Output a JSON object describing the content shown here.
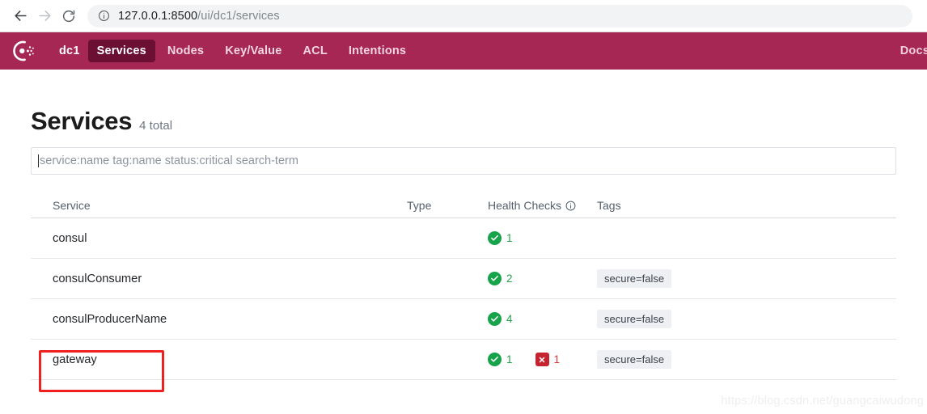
{
  "browser": {
    "back_icon": "arrow-left-icon",
    "forward_icon": "arrow-right-icon",
    "reload_icon": "reload-icon",
    "site_info_icon": "info-circle-icon",
    "url_host": "127.0.0.1:8500",
    "url_path": "/ui/dc1/services",
    "url_full": "127.0.0.1:8500/ui/dc1/services"
  },
  "nav": {
    "logo_icon": "consul-logo-icon",
    "brand_color": "#a62654",
    "active_bg_color": "#6b0f33",
    "datacenter": "dc1",
    "items": [
      {
        "label": "Services",
        "active": true
      },
      {
        "label": "Nodes",
        "active": false
      },
      {
        "label": "Key/Value",
        "active": false
      },
      {
        "label": "ACL",
        "active": false
      },
      {
        "label": "Intentions",
        "active": false
      }
    ],
    "right_label": "Docs"
  },
  "header": {
    "title": "Services",
    "count": "4 total"
  },
  "search": {
    "placeholder": "service:name tag:name status:critical search-term",
    "value": ""
  },
  "table": {
    "columns": [
      "Service",
      "Type",
      "Health Checks",
      "Tags"
    ],
    "health_info_icon": "info-circle-icon",
    "rows": [
      {
        "service": "consul",
        "type": "",
        "health": {
          "passing": "1",
          "failing": ""
        },
        "tags": []
      },
      {
        "service": "consulConsumer",
        "type": "",
        "health": {
          "passing": "2",
          "failing": ""
        },
        "tags": [
          "secure=false"
        ]
      },
      {
        "service": "consulProducerName",
        "type": "",
        "health": {
          "passing": "4",
          "failing": ""
        },
        "tags": [
          "secure=false"
        ]
      },
      {
        "service": "gateway",
        "type": "",
        "health": {
          "passing": "1",
          "failing": "1"
        },
        "tags": [
          "secure=false"
        ]
      }
    ]
  },
  "annotation": {
    "color": "#f02020",
    "target": "gateway"
  },
  "watermark": {
    "text": "https://blog.csdn.net/guangcaiwudong"
  },
  "colors": {
    "pass_green": "#16a34a",
    "fail_red": "#c62330",
    "tag_bg": "#eef0f3"
  }
}
